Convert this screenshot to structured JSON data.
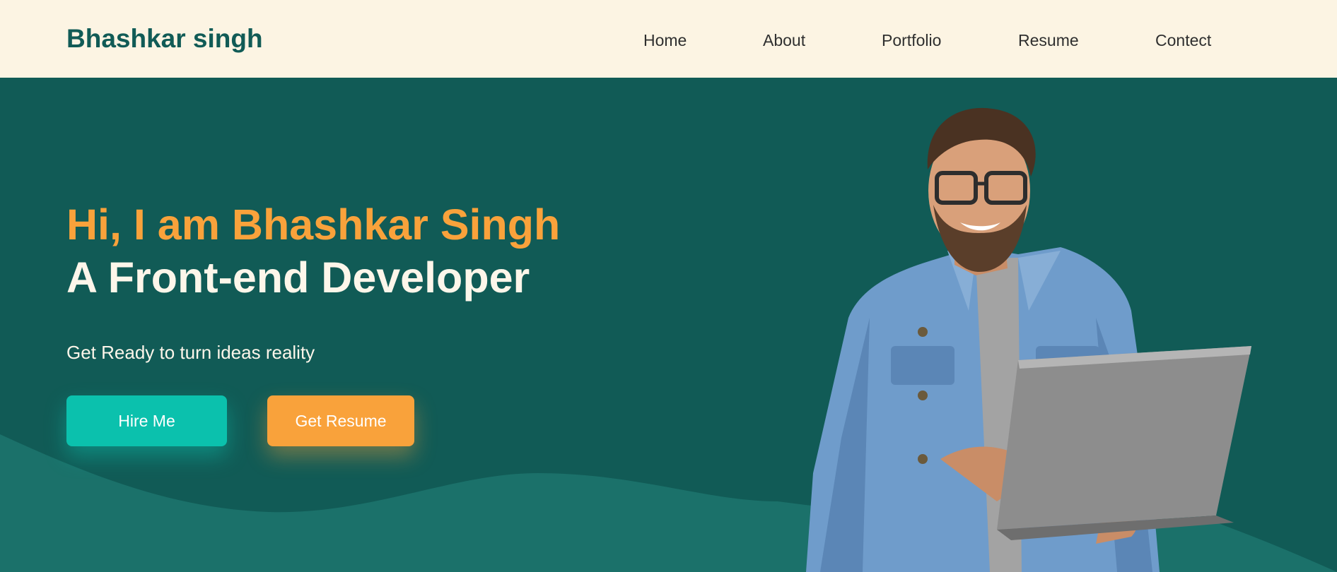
{
  "brand": {
    "name": "Bhashkar singh"
  },
  "nav": {
    "items": [
      {
        "label": "Home"
      },
      {
        "label": "About"
      },
      {
        "label": "Portfolio"
      },
      {
        "label": "Resume"
      },
      {
        "label": "Contect"
      }
    ]
  },
  "hero": {
    "greeting": "Hi, I am Bhashkar Singh",
    "role": "A Front-end Developer",
    "tagline": "Get Ready to turn ideas reality",
    "hire_button": "Hire Me",
    "resume_button": "Get Resume",
    "image_icon": "developer-with-laptop-photo"
  },
  "colors": {
    "header_bg": "#fcf4e3",
    "hero_bg": "#115b56",
    "wave": "#1b716a",
    "brand": "#115b56",
    "accent_orange": "#f9a23b",
    "accent_teal": "#0bc1ad",
    "text_light": "#fdf6ea"
  }
}
